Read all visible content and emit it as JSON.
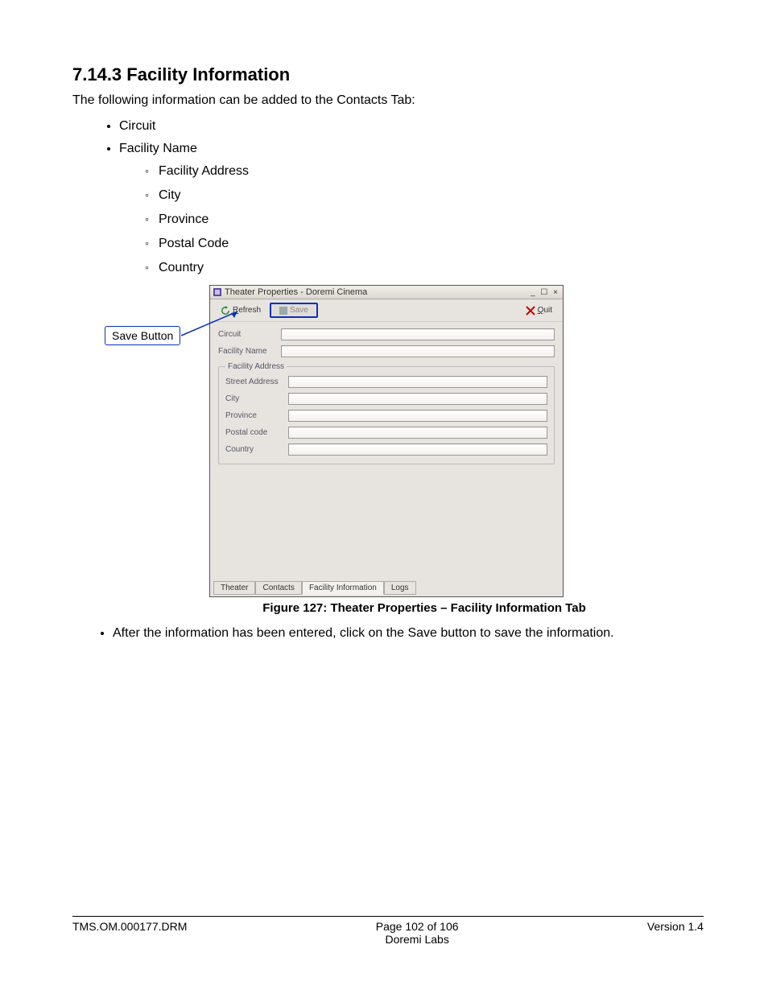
{
  "heading": "7.14.3 Facility Information",
  "intro": "The following information can be added to the Contacts Tab:",
  "bullets": {
    "b1": "Circuit",
    "b2": "Facility Name",
    "sub1": "Facility Address",
    "sub2": "City",
    "sub3": "Province",
    "sub4": "Postal Code",
    "sub5": "Country"
  },
  "callout": {
    "label": "Save Button"
  },
  "window": {
    "title": "Theater Properties - Doremi Cinema",
    "controls": "_ ☐ ×",
    "toolbar": {
      "refresh": "Refresh",
      "save": "Save",
      "quit": "Quit"
    },
    "fields": {
      "circuit": "Circuit",
      "facility_name": "Facility Name",
      "address_group": "Facility Address",
      "street": "Street Address",
      "city": "City",
      "province": "Province",
      "postal": "Postal code",
      "country": "Country"
    },
    "tabs": {
      "theater": "Theater",
      "contacts": "Contacts",
      "facility": "Facility Information",
      "logs": "Logs"
    }
  },
  "caption": "Figure 127: Theater Properties – Facility Information Tab",
  "after_bullet": "After the information has been entered, click on the Save button to save the information.",
  "footer": {
    "left": "TMS.OM.000177.DRM",
    "mid_line1": "Page 102 of 106",
    "mid_line2": "Doremi Labs",
    "right": "Version 1.4"
  }
}
